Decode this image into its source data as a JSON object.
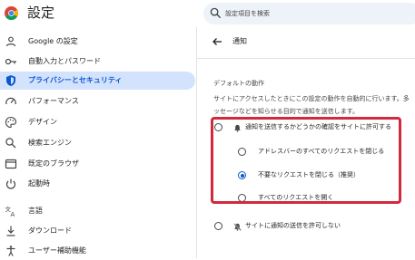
{
  "app": {
    "title": "設定"
  },
  "search": {
    "placeholder": "設定項目を検索"
  },
  "sidebar": {
    "items": [
      {
        "label": "Google の設定",
        "icon": "person-icon",
        "active": false
      },
      {
        "label": "自動入力とパスワード",
        "icon": "key-icon",
        "active": false
      },
      {
        "label": "プライバシーとセキュリティ",
        "icon": "shield-icon",
        "active": true
      },
      {
        "label": "パフォーマンス",
        "icon": "speedometer-icon",
        "active": false
      },
      {
        "label": "デザイン",
        "icon": "palette-icon",
        "active": false
      },
      {
        "label": "検索エンジン",
        "icon": "search-icon",
        "active": false
      },
      {
        "label": "既定のブラウザ",
        "icon": "browser-window-icon",
        "active": false
      },
      {
        "label": "起動時",
        "icon": "power-icon",
        "active": false
      },
      {
        "label": "言語",
        "icon": "translate-icon",
        "active": false
      },
      {
        "label": "ダウンロード",
        "icon": "download-icon",
        "active": false
      },
      {
        "label": "ユーザー補助機能",
        "icon": "accessibility-icon",
        "active": false
      }
    ]
  },
  "main": {
    "back_icon": "back-arrow-icon",
    "page_title": "通知",
    "section_title": "デフォルトの動作",
    "section_desc_line1": "サイトにアクセスしたときにこの設定の動作を自動的に行います。多",
    "section_desc_line2": "ッセージなどを知らせる目的で通知を送信します。",
    "options": {
      "allow_ask": {
        "label": "通知を送信するかどうかの確認をサイトに許可する",
        "icon": "bell-icon",
        "checked": false
      },
      "expand_all": {
        "label": "アドレスバーのすべてのリクエストを閉じる",
        "checked": false
      },
      "collapse_unwanted": {
        "label": "不要なリクエストを閉じる（推奨）",
        "checked": true
      },
      "expand_requests": {
        "label": "すべてのリクエストを開く",
        "checked": false
      },
      "block": {
        "label": "サイトに通知の送信を許可しない",
        "icon": "bell-off-icon",
        "checked": false
      }
    }
  },
  "colors": {
    "accent": "#0b57d0",
    "active_bg": "#d3e3fd",
    "highlight_border": "#d1293d",
    "search_bg": "#eef2f9"
  }
}
